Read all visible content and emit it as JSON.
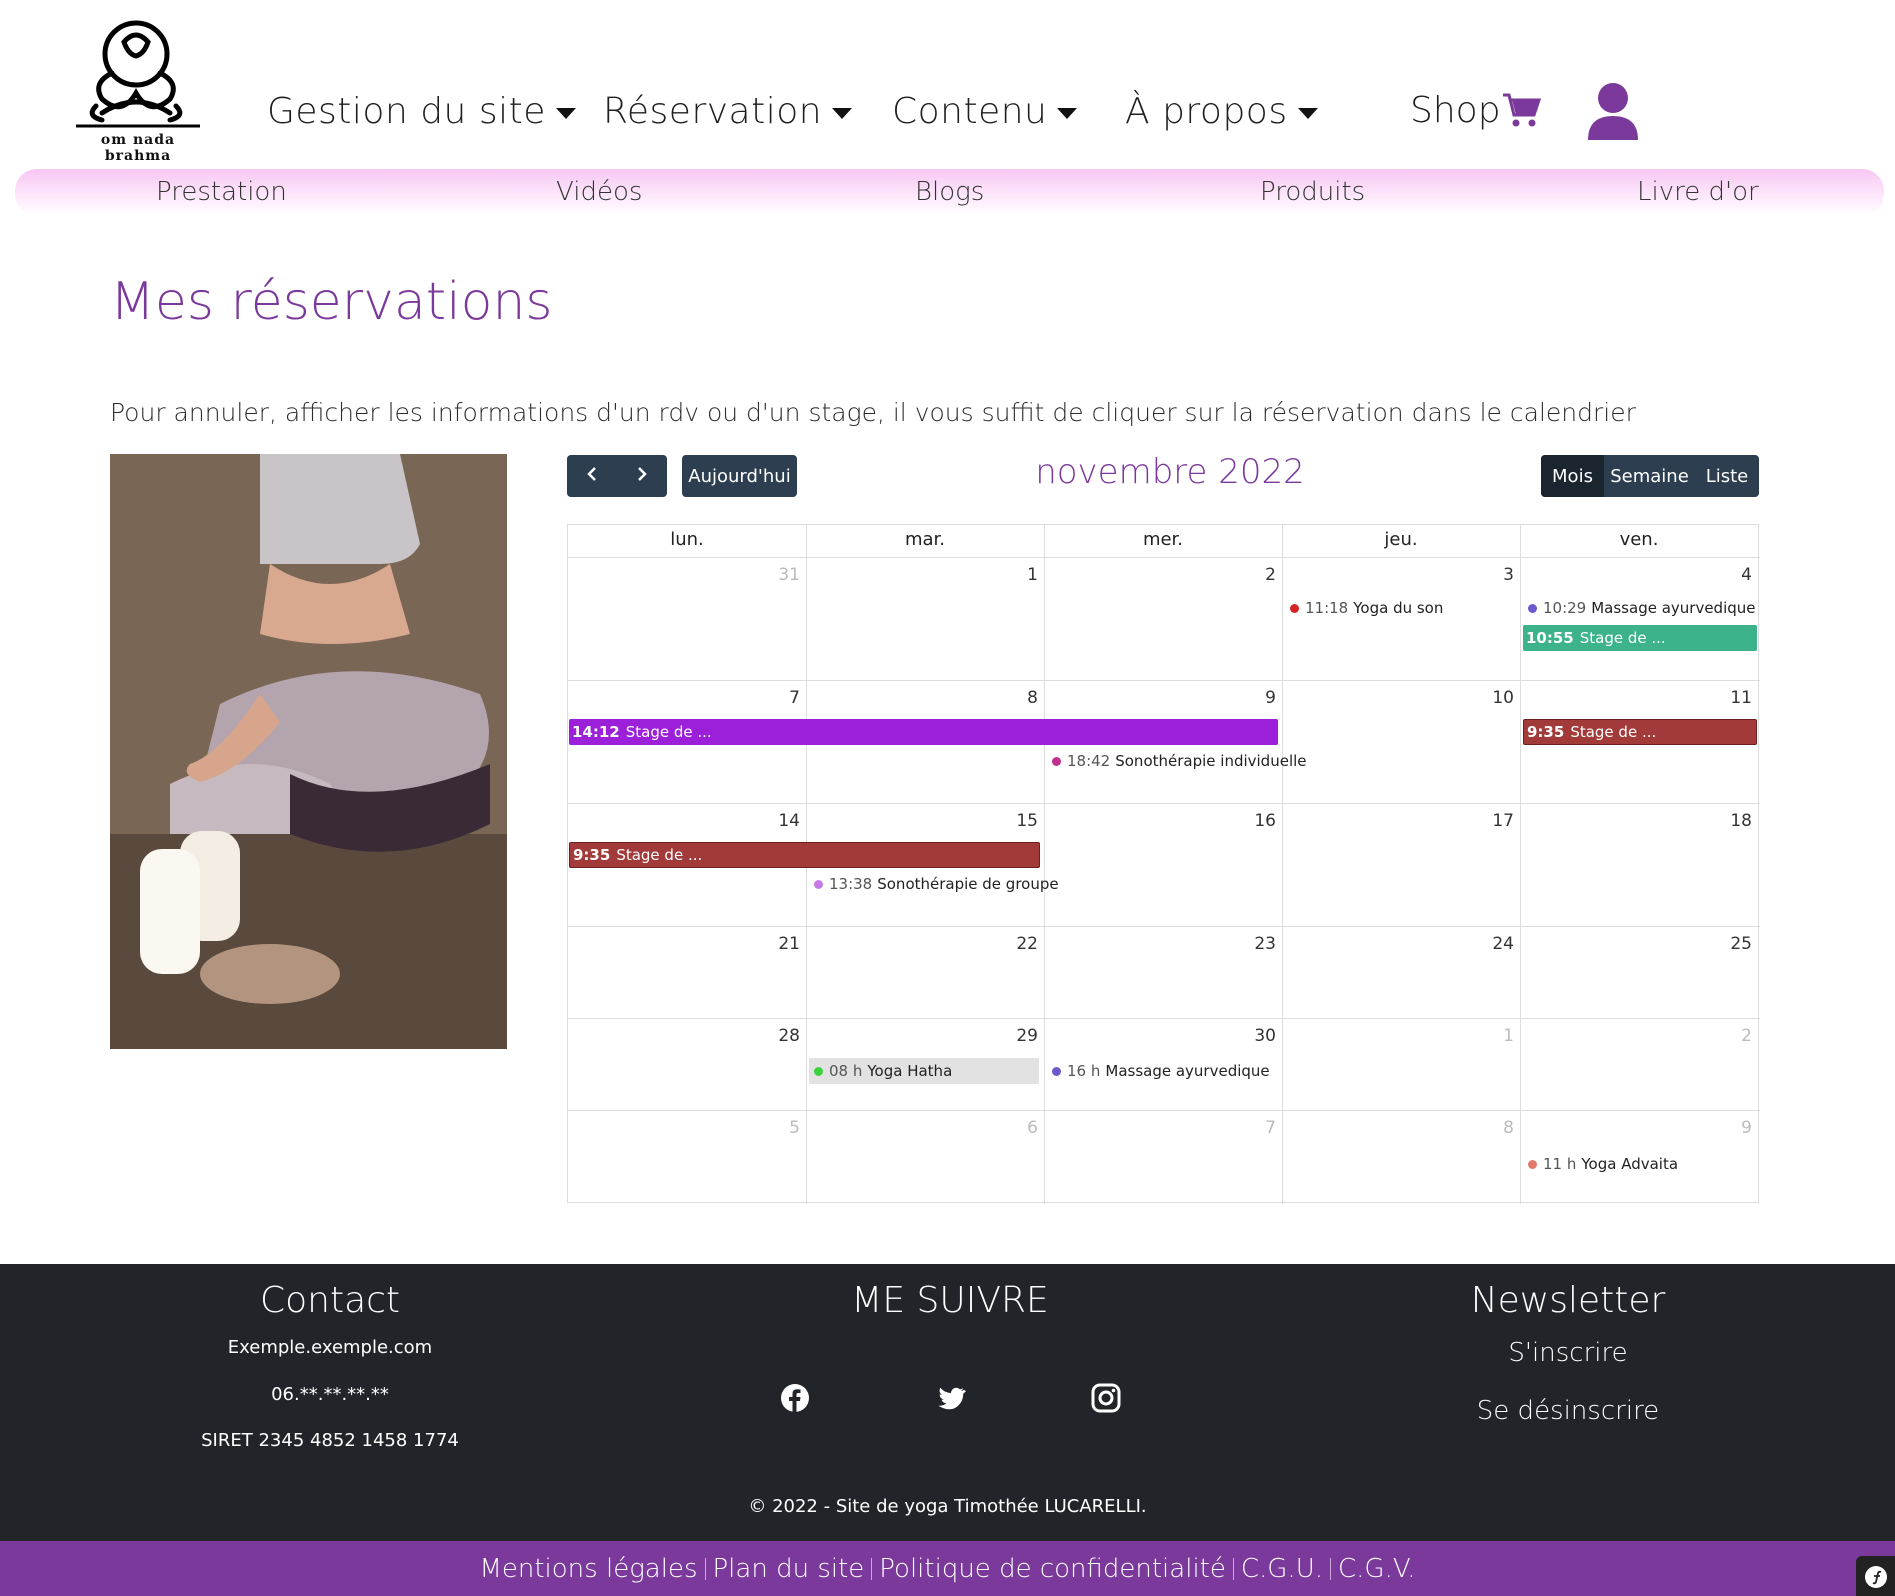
{
  "brand": {
    "logo_text": "om nada brahma"
  },
  "nav": {
    "items": [
      "Gestion du site",
      "Réservation",
      "Contenu",
      "À propos"
    ],
    "shop": "Shop"
  },
  "subnav": [
    "Prestation",
    "Vidéos",
    "Blogs",
    "Produits",
    "Livre d'or"
  ],
  "page": {
    "title": "Mes réservations",
    "intro": "Pour annuler, afficher les informations d'un rdv ou d'un stage, il vous suffit de cliquer sur la réservation dans le calendrier"
  },
  "calendar": {
    "today_label": "Aujourd'hui",
    "title": "novembre 2022",
    "views": [
      "Mois",
      "Semaine",
      "Liste"
    ],
    "active_view": "Mois",
    "day_headers": [
      "lun.",
      "mar.",
      "mer.",
      "jeu.",
      "ven."
    ],
    "weeks": [
      [
        "31",
        "1",
        "2",
        "3",
        "4"
      ],
      [
        "7",
        "8",
        "9",
        "10",
        "11"
      ],
      [
        "14",
        "15",
        "16",
        "17",
        "18"
      ],
      [
        "21",
        "22",
        "23",
        "24",
        "25"
      ],
      [
        "28",
        "29",
        "30",
        "1",
        "2"
      ],
      [
        "5",
        "6",
        "7",
        "8",
        "9"
      ]
    ],
    "events": {
      "e1": {
        "time": "11:18",
        "title": "Yoga du son",
        "color": "#d42525"
      },
      "e2": {
        "time": "10:29",
        "title": "Massage ayurvedique",
        "color": "#6a5acd"
      },
      "e3": {
        "time": "10:55",
        "title": "Stage de ...",
        "color": "#3cb38b"
      },
      "e4": {
        "time": "14:12",
        "title": "Stage de ...",
        "color": "#9c1fd9"
      },
      "e5": {
        "time": "9:35",
        "title": "Stage de ...",
        "color": "#a23a3a"
      },
      "e6": {
        "time": "18:42",
        "title": "Sonothérapie individuelle",
        "color": "#c0308f"
      },
      "e7": {
        "time": "9:35",
        "title": "Stage de ...",
        "color": "#a23a3a"
      },
      "e8": {
        "time": "13:38",
        "title": "Sonothérapie de groupe",
        "color": "#c77ae6"
      },
      "e9": {
        "time": "08 h",
        "title": "Yoga Hatha",
        "color": "#3bd13b"
      },
      "e10": {
        "time": "16 h",
        "title": "Massage ayurvedique",
        "color": "#6a5acd"
      },
      "e11": {
        "time": "11 h",
        "title": "Yoga Advaita",
        "color": "#e07a6a"
      }
    }
  },
  "footer": {
    "contact_title": "Contact",
    "email": "Exemple.exemple.com",
    "phone": "06.**.**.**.**",
    "siret": "SIRET 2345 4852 1458 1774",
    "follow_title": "ME SUIVRE",
    "social": [
      "facebook-icon",
      "twitter-icon",
      "instagram-icon"
    ],
    "newsletter_title": "Newsletter",
    "subscribe": "S'inscrire",
    "unsubscribe": "Se désinscrire",
    "copyright": "© 2022 - Site de yoga Timothée LUCARELLI."
  },
  "legal_links": [
    "Mentions légales",
    "Plan du site",
    "Politique de confidentialité",
    "C.G.U.",
    "C.G.V."
  ],
  "colors": {
    "accent": "#7b3a9b",
    "dark": "#212529",
    "button": "#2c3e50"
  }
}
